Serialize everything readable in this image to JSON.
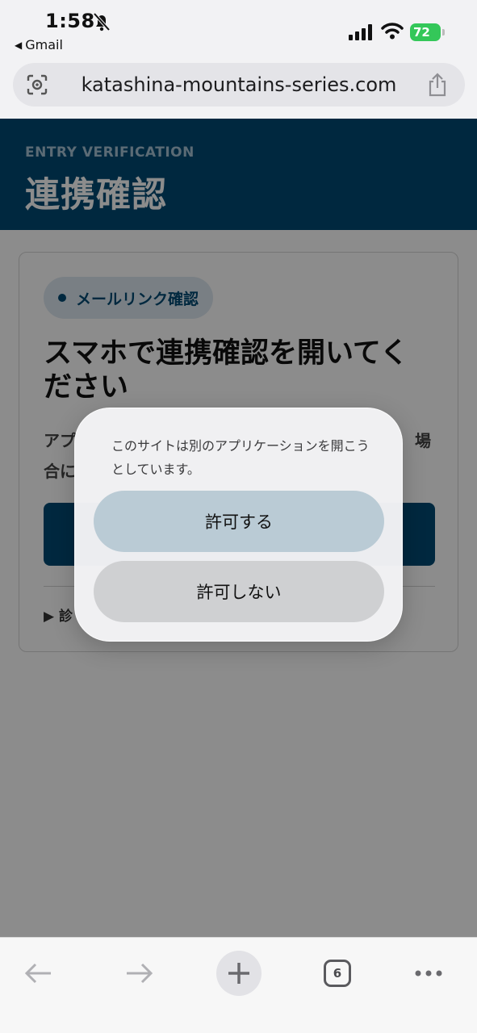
{
  "status_bar": {
    "time": "1:58",
    "back_app": "Gmail",
    "battery": "72",
    "icons": [
      "bell-slash-icon",
      "signal-icon",
      "wifi-icon",
      "battery-charging-icon"
    ]
  },
  "address_bar": {
    "url": "katashina-mountains-series.com",
    "icons": [
      "page-lens-icon",
      "share-icon"
    ]
  },
  "page": {
    "eyebrow": "ENTRY VERIFICATION",
    "title": "連携確認",
    "card": {
      "badge": "メールリンク確認",
      "title": "スマホで連携確認を開いてください",
      "body_start": "アプ",
      "body_end": "場",
      "body_line2": "合に",
      "details": "▶ 診"
    }
  },
  "alert": {
    "message": "このサイトは別のアプリケーションを開こうとしています。",
    "allow": "許可する",
    "deny": "許可しない"
  },
  "toolbar": {
    "tab_count": "6",
    "icons": [
      "back-arrow-icon",
      "forward-arrow-icon",
      "plus-icon",
      "tabs-icon",
      "more-icon"
    ]
  },
  "colors": {
    "header": "#004a73",
    "battery": "#34c759"
  }
}
